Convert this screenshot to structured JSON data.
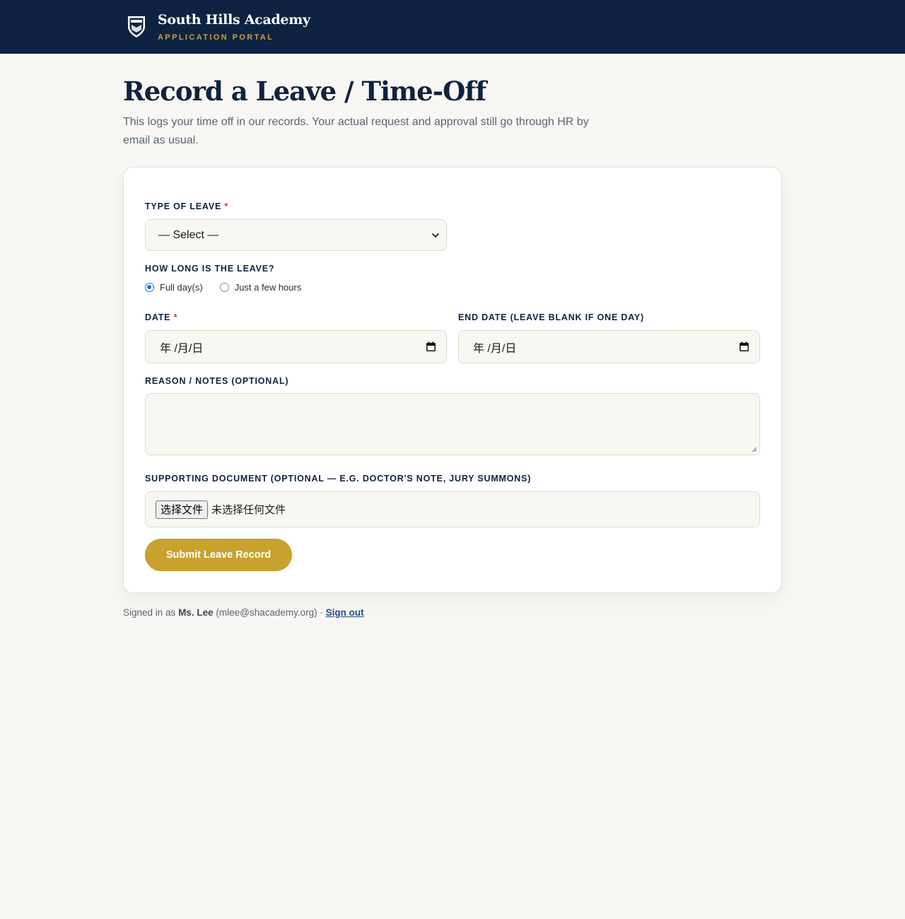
{
  "header": {
    "brand_title": "South Hills Academy",
    "brand_subtitle": "APPLICATION PORTAL",
    "logo_icon": "crest-icon"
  },
  "page": {
    "title": "Record a Leave / Time-Off",
    "description": "This logs your time off in our records. Your actual request and approval still go through HR by email as usual."
  },
  "form": {
    "leave_type": {
      "label": "TYPE OF LEAVE",
      "required_mark": "*",
      "value": "— Select —"
    },
    "duration": {
      "label": "HOW LONG IS THE LEAVE?",
      "options": [
        {
          "label": "Full day(s)",
          "selected": true
        },
        {
          "label": "Just a few hours",
          "selected": false
        }
      ]
    },
    "date": {
      "label": "DATE",
      "required_mark": "*",
      "placeholder": "年 /月/日"
    },
    "end_date": {
      "label": "END DATE (LEAVE BLANK IF ONE DAY)",
      "placeholder": "年 /月/日"
    },
    "notes": {
      "label": "REASON / NOTES (OPTIONAL)",
      "value": ""
    },
    "document": {
      "label": "SUPPORTING DOCUMENT (OPTIONAL — E.G. DOCTOR'S NOTE, JURY SUMMONS)",
      "button_label": "选择文件",
      "status": "未选择任何文件"
    },
    "submit_label": "Submit Leave Record"
  },
  "footer": {
    "prefix": "Signed in as",
    "user_name": "Ms. Lee",
    "user_email": "(mlee@shacademy.org)",
    "separator": "·",
    "signout_label": "Sign out"
  },
  "colors": {
    "navy": "#0e2342",
    "gold": "#c9a22e",
    "background": "#f8f7f3",
    "required": "#c0392b",
    "link": "#1e4b8f"
  }
}
